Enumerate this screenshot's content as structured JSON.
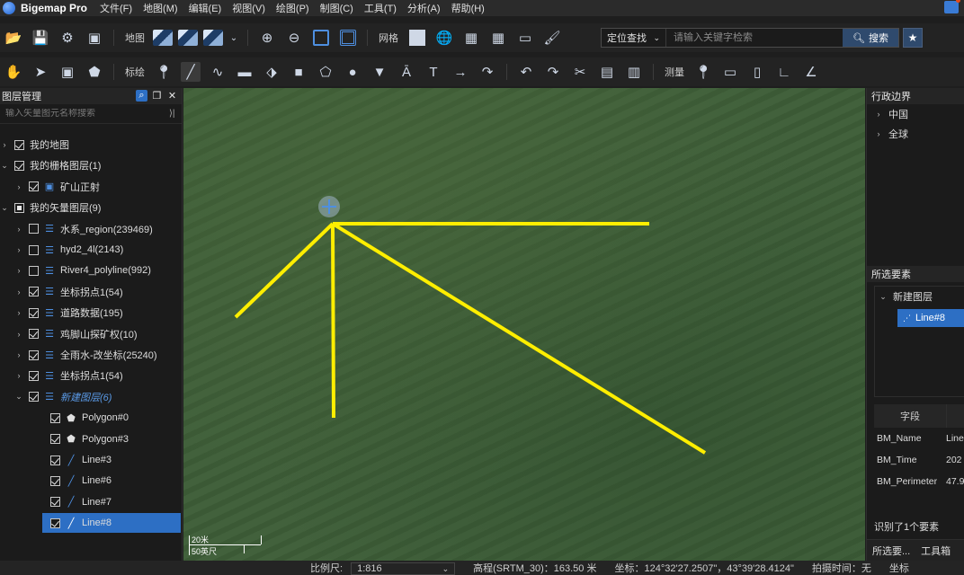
{
  "app": {
    "title": "Bigemap Pro"
  },
  "menu": [
    "文件(F)",
    "地图(M)",
    "编辑(E)",
    "视图(V)",
    "绘图(P)",
    "制图(C)",
    "工具(T)",
    "分析(A)",
    "帮助(H)"
  ],
  "toolbar1": {
    "map_label": "地图",
    "grid_label": "网格",
    "search_mode": "定位查找",
    "search_placeholder": "请输入关键字检索",
    "search_button": "搜索"
  },
  "toolbar2": {
    "annotate_label": "标绘",
    "measure_label": "测量"
  },
  "left_panel": {
    "title": "图层管理",
    "filter_placeholder": "输入矢量图元名称搜索",
    "tree": [
      {
        "label": "我的地图",
        "level": 0,
        "chevron": "›",
        "check": "checked",
        "icon": ""
      },
      {
        "label": "我的栅格图层(1)",
        "level": 0,
        "chevron": "⌄",
        "check": "checked",
        "icon": ""
      },
      {
        "label": "矿山正射",
        "level": 1,
        "chevron": "›",
        "check": "checked",
        "icon": "image-icon"
      },
      {
        "label": "我的矢量图层(9)",
        "level": 0,
        "chevron": "⌄",
        "check": "partial",
        "icon": ""
      },
      {
        "label": "水系_region(239469)",
        "level": 1,
        "chevron": "›",
        "check": "unchecked",
        "icon": "layers-icon"
      },
      {
        "label": "hyd2_4l(2143)",
        "level": 1,
        "chevron": "›",
        "check": "unchecked",
        "icon": "layers-icon"
      },
      {
        "label": "River4_polyline(992)",
        "level": 1,
        "chevron": "›",
        "check": "unchecked",
        "icon": "layers-icon"
      },
      {
        "label": "坐标拐点1(54)",
        "level": 1,
        "chevron": "›",
        "check": "checked",
        "icon": "layers-icon"
      },
      {
        "label": "道路数据(195)",
        "level": 1,
        "chevron": "›",
        "check": "checked",
        "icon": "layers-icon"
      },
      {
        "label": "鸡脚山探矿权(10)",
        "level": 1,
        "chevron": "›",
        "check": "checked",
        "icon": "layers-icon"
      },
      {
        "label": "全雨水-改坐标(25240)",
        "level": 1,
        "chevron": "›",
        "check": "checked",
        "icon": "layers-icon"
      },
      {
        "label": "坐标拐点1(54)",
        "level": 1,
        "chevron": "›",
        "check": "checked",
        "icon": "layers-icon"
      },
      {
        "label": "新建图层(6)",
        "level": 1,
        "chevron": "⌄",
        "check": "checked",
        "icon": "layers-icon",
        "italic": true
      },
      {
        "label": "Polygon#0",
        "level": 2,
        "chevron": "",
        "check": "checked",
        "icon": "polygon-icon"
      },
      {
        "label": "Polygon#3",
        "level": 2,
        "chevron": "",
        "check": "checked",
        "icon": "polygon-icon"
      },
      {
        "label": "Line#3",
        "level": 2,
        "chevron": "",
        "check": "checked",
        "icon": "line-icon"
      },
      {
        "label": "Line#6",
        "level": 2,
        "chevron": "",
        "check": "checked",
        "icon": "line-icon"
      },
      {
        "label": "Line#7",
        "level": 2,
        "chevron": "",
        "check": "checked",
        "icon": "line-icon"
      },
      {
        "label": "Line#8",
        "level": 2,
        "chevron": "",
        "check": "checked",
        "icon": "line-icon",
        "selected": true
      }
    ]
  },
  "map": {
    "scale_top": "20米",
    "scale_bottom": "50英尺",
    "line_color": "#ffee00"
  },
  "right_panel": {
    "admin_title": "行政边界",
    "admin_items": [
      "中国",
      "全球"
    ],
    "selected_title": "所选要素",
    "selected_layer": "新建图层",
    "selected_item": "Line#8",
    "field_header": "字段",
    "attributes": [
      {
        "key": "BM_Name",
        "value": "Line"
      },
      {
        "key": "BM_Time",
        "value": "202"
      },
      {
        "key": "BM_Perimeter",
        "value": "47.9"
      }
    ],
    "identify_text": "识别了1个要素",
    "tabs": [
      "所选要...",
      "工具箱"
    ]
  },
  "status": {
    "scale_label": "比例尺:",
    "scale_value": "1:816",
    "elevation": "高程(SRTM_30)：163.50 米",
    "coords": "坐标：124°32'27.2507\"，43°39'28.4124\"",
    "shot_time": "拍摄时间：无",
    "extra": "坐标"
  }
}
